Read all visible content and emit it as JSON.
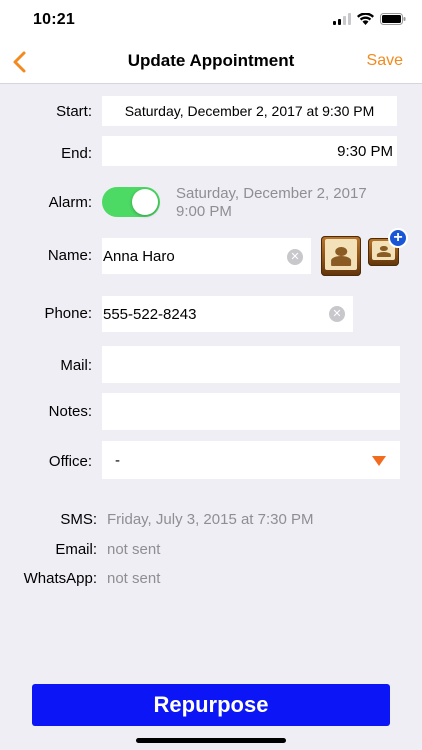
{
  "status_bar": {
    "time": "10:21"
  },
  "nav": {
    "title": "Update Appointment",
    "save_label": "Save"
  },
  "form": {
    "start": {
      "label": "Start:",
      "value": "Saturday, December 2, 2017 at 9:30 PM"
    },
    "end": {
      "label": "End:",
      "value": "9:30 PM"
    },
    "alarm": {
      "label": "Alarm:",
      "enabled": true,
      "date_line1": "Saturday, December 2, 2017",
      "date_line2": "9:00 PM"
    },
    "name": {
      "label": "Name:",
      "value": "Anna Haro"
    },
    "phone": {
      "label": "Phone:",
      "value": "555-522-8243"
    },
    "mail": {
      "label": "Mail:",
      "value": ""
    },
    "notes": {
      "label": "Notes:",
      "value": ""
    },
    "office": {
      "label": "Office:",
      "value": "-"
    }
  },
  "notifications": {
    "sms": {
      "label": "SMS:",
      "value": "Friday, July 3, 2015 at 7:30 PM"
    },
    "email": {
      "label": "Email:",
      "value": "not sent"
    },
    "whatsapp": {
      "label": "WhatsApp:",
      "value": "not sent"
    }
  },
  "actions": {
    "repurpose_label": "Repurpose"
  },
  "colors": {
    "accent": "#f28a1f",
    "toggle_on": "#4cd964",
    "primary_button": "#0b15f5"
  }
}
